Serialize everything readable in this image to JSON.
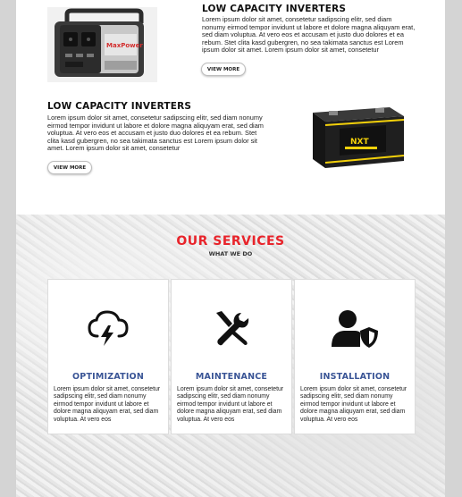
{
  "products": [
    {
      "title": "LOW CAPACITY INVERTERS",
      "text": "Lorem ipsum dolor sit amet, consetetur sadipscing elitr, sed diam nonumy eirmod tempor invidunt ut labore et dolore magna aliquyam erat, sed diam voluptua. At vero eos et accusam et justo duo dolores et ea rebum. Stet clita kasd gubergren, no sea takimata sanctus est Lorem ipsum dolor sit amet. Lorem ipsum dolor sit amet, consetetur",
      "button_label": "VIEW MORE",
      "image": "portable-power-station",
      "image_brand_text": "MaxPower"
    },
    {
      "title": "LOW CAPACITY INVERTERS",
      "text": "Lorem ipsum dolor sit amet, consetetur sadipscing elitr, sed diam nonumy eirmod tempor invidunt ut labore et dolore magna aliquyam erat, sed diam voluptua. At vero eos et accusam et justo duo dolores et ea rebum. Stet clita kasd gubergren, no sea takimata sanctus est Lorem ipsum dolor sit amet. Lorem ipsum dolor sit amet, consetetur",
      "button_label": "VIEW MORE",
      "image": "battery",
      "image_brand_text": "NXT"
    }
  ],
  "services": {
    "title": "OUR SERVICES",
    "subtitle": "WHAT WE DO",
    "cards": [
      {
        "icon": "cloud-lightning-icon",
        "title": "OPTIMIZATION",
        "text": "Lorem ipsum dolor sit amet, consetetur sadipscing elitr, sed diam nonumy eirmod tempor invidunt ut labore et dolore magna aliquyam erat, sed diam voluptua. At vero eos"
      },
      {
        "icon": "tools-icon",
        "title": "MAINTENANCE",
        "text": "Lorem ipsum dolor sit amet, consetetur sadipscing elitr, sed diam nonumy eirmod tempor invidunt ut labore et dolore magna aliquyam erat, sed diam voluptua. At vero eos"
      },
      {
        "icon": "user-shield-icon",
        "title": "INSTALLATION",
        "text": "Lorem ipsum dolor sit amet, consetetur sadipscing elitr, sed diam nonumy eirmod tempor invidunt ut labore et dolore magna aliquyam erat, sed diam voluptua. At vero eos"
      }
    ]
  },
  "colors": {
    "accent_red": "#e8242b",
    "service_title_blue": "#3a5596",
    "page_background": "#d4d4d4"
  }
}
